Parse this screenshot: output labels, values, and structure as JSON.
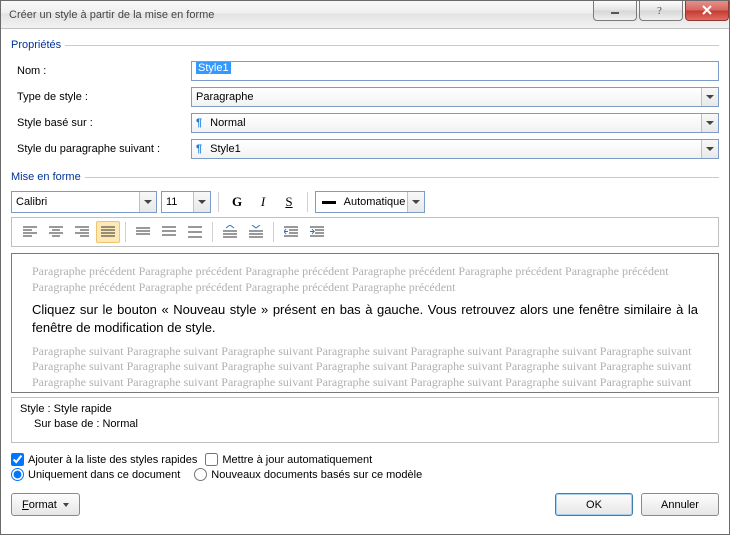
{
  "titlebar": {
    "title": "Créer un style à partir de la mise en forme"
  },
  "groups": {
    "properties": "Propriétés",
    "formatting": "Mise en forme"
  },
  "props": {
    "name_label": "Nom :",
    "name_value": "Style1",
    "type_label": "Type de style :",
    "type_value": "Paragraphe",
    "based_label": "Style basé sur :",
    "based_value": "Normal",
    "following_label": "Style du paragraphe suivant :",
    "following_value": "Style1"
  },
  "fmt": {
    "font": "Calibri",
    "size": "11",
    "bold": "G",
    "italic": "I",
    "underline": "S",
    "color_label": "Automatique"
  },
  "preview": {
    "before": "Paragraphe précédent Paragraphe précédent Paragraphe précédent Paragraphe précédent Paragraphe précédent Paragraphe précédent Paragraphe précédent Paragraphe précédent Paragraphe précédent Paragraphe précédent",
    "main": "Cliquez sur le bouton « Nouveau style » présent en bas à gauche. Vous retrouvez alors une fenêtre similaire à la fenêtre de modification de style.",
    "after": "Paragraphe suivant Paragraphe suivant Paragraphe suivant Paragraphe suivant Paragraphe suivant Paragraphe suivant Paragraphe suivant Paragraphe suivant Paragraphe suivant Paragraphe suivant Paragraphe suivant Paragraphe suivant Paragraphe suivant Paragraphe suivant Paragraphe suivant Paragraphe suivant Paragraphe suivant Paragraphe suivant Paragraphe suivant Paragraphe suivant Paragraphe suivant Paragraphe suivant Paragraphe suivant Paragraphe suivant"
  },
  "summary": {
    "line1": "Style : Style rapide",
    "line2": "Sur base de : Normal"
  },
  "options": {
    "quick_list": "Ajouter à la liste des styles rapides",
    "auto_update": "Mettre à jour automatiquement",
    "this_doc": "Uniquement dans ce document",
    "new_docs": "Nouveaux documents basés sur ce modèle"
  },
  "buttons": {
    "format": "ormat",
    "format_u": "F",
    "ok": "OK",
    "cancel": "Annuler"
  }
}
